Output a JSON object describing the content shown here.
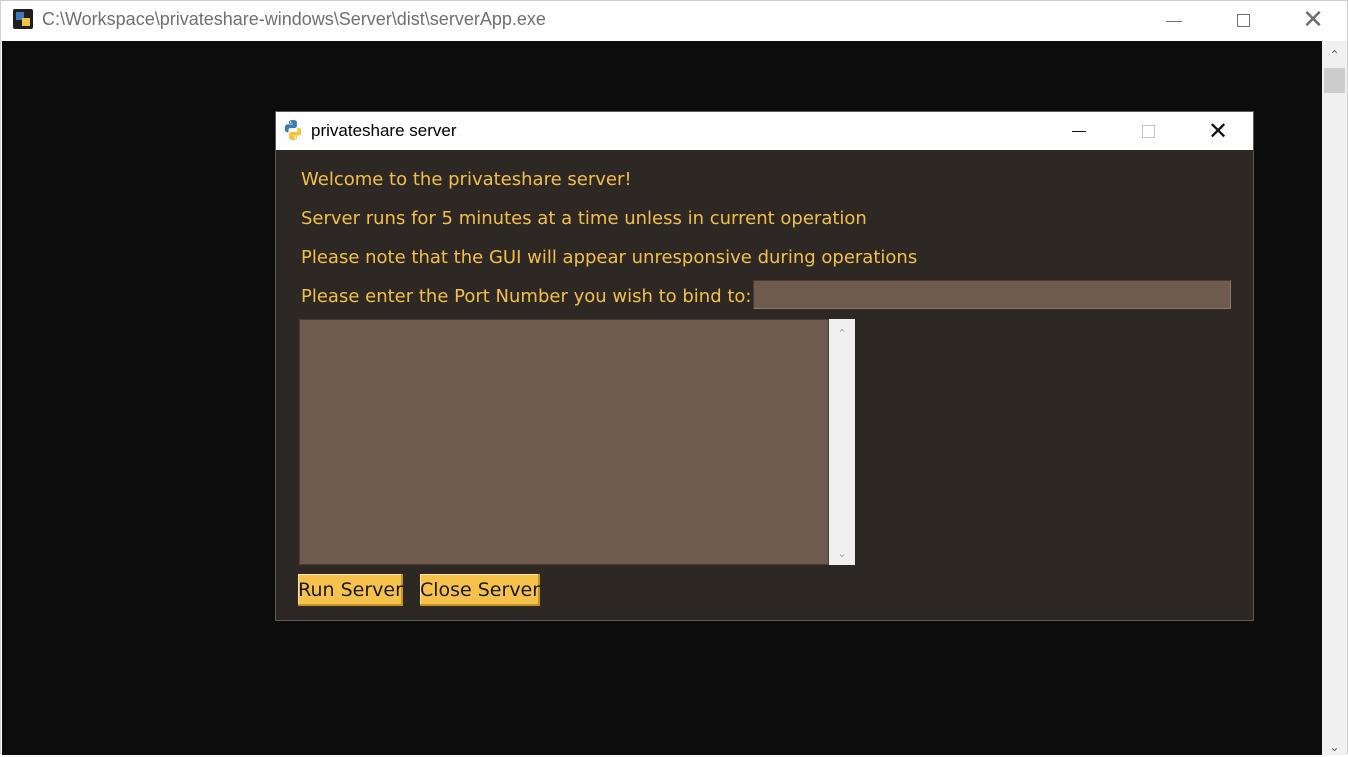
{
  "console": {
    "title": "C:\\Workspace\\privateshare-windows\\Server\\dist\\serverApp.exe",
    "minimize_label": "Minimize",
    "maximize_label": "Maximize",
    "close_label": "Close",
    "scroll_up_glyph": "⌃",
    "scroll_down_glyph": "⌄"
  },
  "app": {
    "title": "privateshare server",
    "lines": {
      "welcome": "Welcome to the privateshare server!",
      "runtime": "Server runs for 5 minutes at a time unless in current operation",
      "note": "Please note that the GUI will appear unresponsive during operations",
      "port_prompt": "Please enter the Port Number you wish to bind to:"
    },
    "port_value": "",
    "log_text": "",
    "buttons": {
      "run": "Run Server",
      "close": "Close Server"
    },
    "scroll_up_glyph": "⌃",
    "scroll_down_glyph": "⌄"
  },
  "colors": {
    "console_bg": "#0c0c0c",
    "app_bg": "#2e2824",
    "label_text": "#f2c04a",
    "field_bg": "#6e5b4e",
    "button_bg": "#f7c24b"
  }
}
